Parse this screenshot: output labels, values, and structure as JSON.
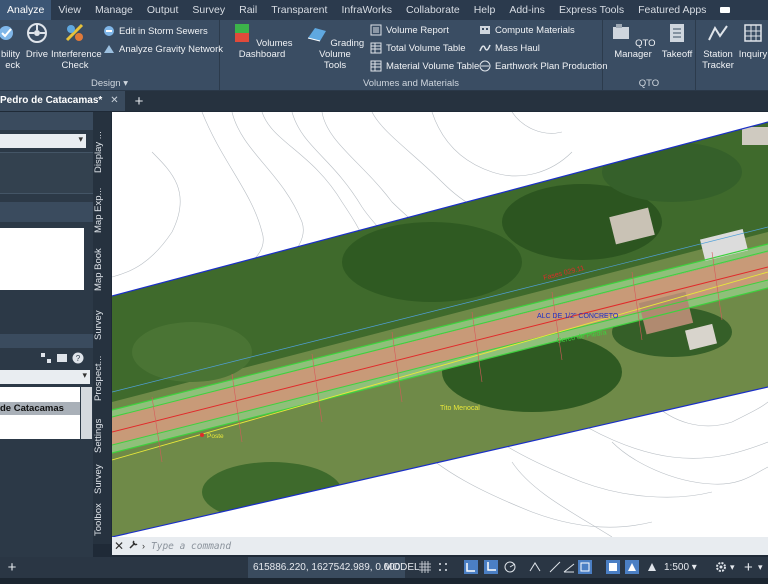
{
  "ribbon_tabs": [
    "Analyze",
    "View",
    "Manage",
    "Output",
    "Survey",
    "Rail",
    "Transparent",
    "InfraWorks",
    "Collaborate",
    "Help",
    "Add-ins",
    "Express Tools",
    "Featured Apps"
  ],
  "active_tab": "Analyze",
  "ribbon": {
    "design": {
      "title": "Design",
      "visibility_check": "bility\neck",
      "drive": "Drive",
      "interference_check": "Interference\nCheck",
      "edit_storm_sewers": "Edit in Storm Sewers",
      "analyze_gravity_network": "Analyze Gravity Network"
    },
    "volumes": {
      "title": "Volumes and Materials",
      "volumes_dashboard": "Volumes Dashboard",
      "grading_volume_tools": "Grading Volume\nTools",
      "volume_report": "Volume Report",
      "total_volume_table": "Total Volume Table",
      "material_volume_table": "Material Volume Table",
      "compute_materials": "Compute Materials",
      "mass_haul": "Mass Haul",
      "earthwork_plan_production": "Earthwork Plan Production"
    },
    "qto": {
      "title": "QTO",
      "qto_manager": "QTO Manager",
      "takeoff": "Takeoff"
    },
    "other": {
      "station_tracker": "Station\nTracker",
      "inquiry": "Inquiry"
    }
  },
  "document_tab": "Pedro de Catacamas*",
  "left_panel": {
    "list_item": "de Catacamas"
  },
  "vertical_tabs": [
    "Display ...",
    "Map Exp...",
    "Map Book",
    "Survey",
    "Prospect...",
    "Settings",
    "Survey",
    "Toolbox"
  ],
  "map_labels": {
    "label_red": "Fases  029.11",
    "label_blue": "ALC DE 1/2\" CONCRETO",
    "label_green": "Cerco de Piedra",
    "label_yellow": "Tito Menocal",
    "label_poste": "Poste"
  },
  "command_placeholder": "Type a command",
  "status": {
    "coords": "615886.220, 1627542.989, 0.000",
    "model": "MODEL",
    "scale": "1:500"
  },
  "colors": {
    "ribbon_bg": "#3a4d63",
    "tab_active": "#3c5675",
    "canvas_bg": "#ffffff"
  }
}
